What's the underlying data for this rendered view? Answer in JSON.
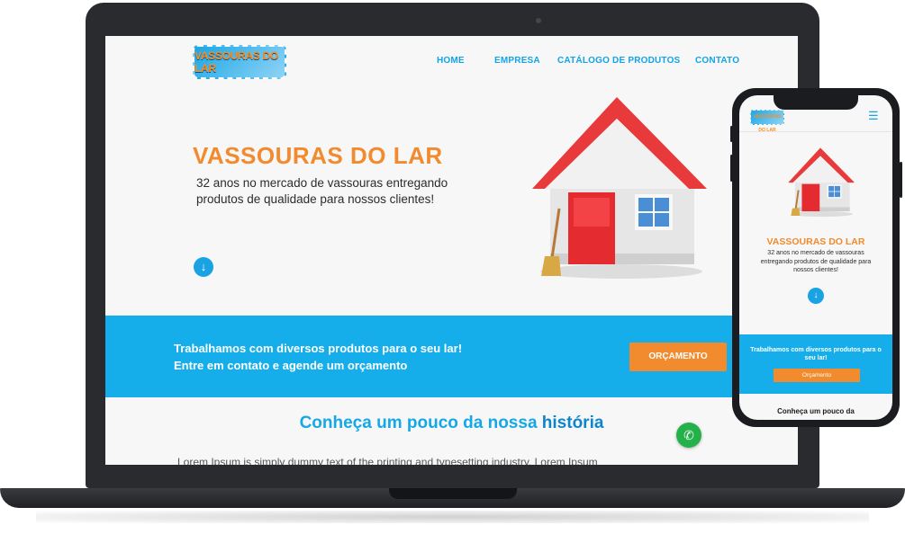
{
  "desktop": {
    "logo_text": "VASSOURAS DO LAR",
    "nav": [
      "HOME",
      "EMPRESA",
      "CATÁLOGO DE PRODUTOS",
      "CONTATO"
    ],
    "hero": {
      "title": "VASSOURAS DO LAR",
      "text": "32 anos no mercado de vassouras entregando produtos de qualidade para nossos clientes!"
    },
    "band": {
      "line1": "Trabalhamos com diversos produtos para o seu lar!",
      "line2": "Entre em contato e agende um orçamento",
      "button": "ORÇAMENTO"
    },
    "history": {
      "title_prefix": "Conheça um pouco da nossa ",
      "title_highlight": "história",
      "body": "Lorem Ipsum is simply dummy text of the printing and typesetting industry. Lorem Ipsum"
    }
  },
  "mobile": {
    "logo_text": "VASSOURAS DO LAR",
    "hero": {
      "title": "VASSOURAS DO LAR",
      "text": "32 anos no mercado de vassouras entregando produtos de qualidade para nossos clientes!"
    },
    "band": {
      "text": "Trabalhamos com diversos produtos para o seu lar!",
      "button": "Orçamento"
    },
    "history_title": "Conheça um pouco da"
  },
  "colors": {
    "brand_blue": "#16aeea",
    "brand_orange": "#f28a2e",
    "whatsapp_green": "#25b14a"
  },
  "icons": {
    "down": "arrow-down-icon",
    "whatsapp": "whatsapp-icon",
    "menu": "hamburger-menu-icon"
  }
}
